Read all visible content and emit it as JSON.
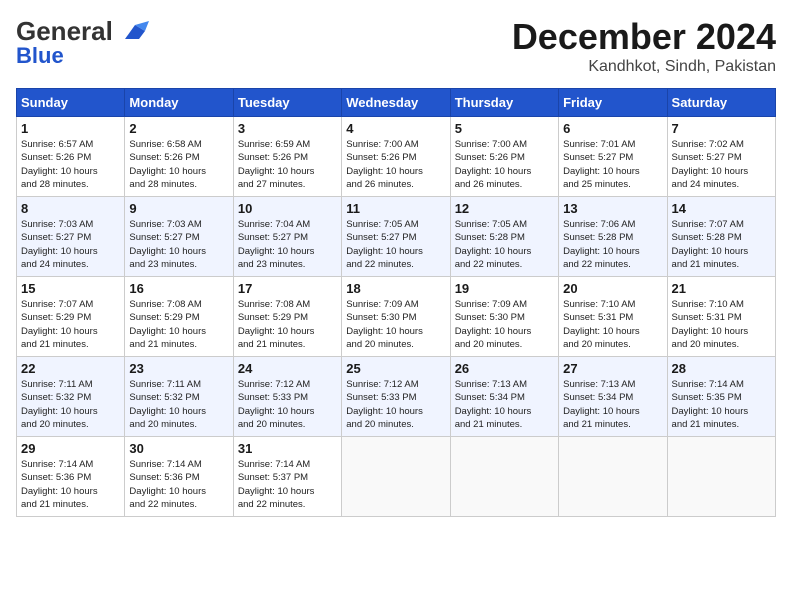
{
  "header": {
    "logo_general": "General",
    "logo_blue": "Blue",
    "month": "December 2024",
    "location": "Kandhkot, Sindh, Pakistan"
  },
  "weekdays": [
    "Sunday",
    "Monday",
    "Tuesday",
    "Wednesday",
    "Thursday",
    "Friday",
    "Saturday"
  ],
  "weeks": [
    [
      {
        "day": "1",
        "detail": "Sunrise: 6:57 AM\nSunset: 5:26 PM\nDaylight: 10 hours\nand 28 minutes."
      },
      {
        "day": "2",
        "detail": "Sunrise: 6:58 AM\nSunset: 5:26 PM\nDaylight: 10 hours\nand 28 minutes."
      },
      {
        "day": "3",
        "detail": "Sunrise: 6:59 AM\nSunset: 5:26 PM\nDaylight: 10 hours\nand 27 minutes."
      },
      {
        "day": "4",
        "detail": "Sunrise: 7:00 AM\nSunset: 5:26 PM\nDaylight: 10 hours\nand 26 minutes."
      },
      {
        "day": "5",
        "detail": "Sunrise: 7:00 AM\nSunset: 5:26 PM\nDaylight: 10 hours\nand 26 minutes."
      },
      {
        "day": "6",
        "detail": "Sunrise: 7:01 AM\nSunset: 5:27 PM\nDaylight: 10 hours\nand 25 minutes."
      },
      {
        "day": "7",
        "detail": "Sunrise: 7:02 AM\nSunset: 5:27 PM\nDaylight: 10 hours\nand 24 minutes."
      }
    ],
    [
      {
        "day": "8",
        "detail": "Sunrise: 7:03 AM\nSunset: 5:27 PM\nDaylight: 10 hours\nand 24 minutes."
      },
      {
        "day": "9",
        "detail": "Sunrise: 7:03 AM\nSunset: 5:27 PM\nDaylight: 10 hours\nand 23 minutes."
      },
      {
        "day": "10",
        "detail": "Sunrise: 7:04 AM\nSunset: 5:27 PM\nDaylight: 10 hours\nand 23 minutes."
      },
      {
        "day": "11",
        "detail": "Sunrise: 7:05 AM\nSunset: 5:27 PM\nDaylight: 10 hours\nand 22 minutes."
      },
      {
        "day": "12",
        "detail": "Sunrise: 7:05 AM\nSunset: 5:28 PM\nDaylight: 10 hours\nand 22 minutes."
      },
      {
        "day": "13",
        "detail": "Sunrise: 7:06 AM\nSunset: 5:28 PM\nDaylight: 10 hours\nand 22 minutes."
      },
      {
        "day": "14",
        "detail": "Sunrise: 7:07 AM\nSunset: 5:28 PM\nDaylight: 10 hours\nand 21 minutes."
      }
    ],
    [
      {
        "day": "15",
        "detail": "Sunrise: 7:07 AM\nSunset: 5:29 PM\nDaylight: 10 hours\nand 21 minutes."
      },
      {
        "day": "16",
        "detail": "Sunrise: 7:08 AM\nSunset: 5:29 PM\nDaylight: 10 hours\nand 21 minutes."
      },
      {
        "day": "17",
        "detail": "Sunrise: 7:08 AM\nSunset: 5:29 PM\nDaylight: 10 hours\nand 21 minutes."
      },
      {
        "day": "18",
        "detail": "Sunrise: 7:09 AM\nSunset: 5:30 PM\nDaylight: 10 hours\nand 20 minutes."
      },
      {
        "day": "19",
        "detail": "Sunrise: 7:09 AM\nSunset: 5:30 PM\nDaylight: 10 hours\nand 20 minutes."
      },
      {
        "day": "20",
        "detail": "Sunrise: 7:10 AM\nSunset: 5:31 PM\nDaylight: 10 hours\nand 20 minutes."
      },
      {
        "day": "21",
        "detail": "Sunrise: 7:10 AM\nSunset: 5:31 PM\nDaylight: 10 hours\nand 20 minutes."
      }
    ],
    [
      {
        "day": "22",
        "detail": "Sunrise: 7:11 AM\nSunset: 5:32 PM\nDaylight: 10 hours\nand 20 minutes."
      },
      {
        "day": "23",
        "detail": "Sunrise: 7:11 AM\nSunset: 5:32 PM\nDaylight: 10 hours\nand 20 minutes."
      },
      {
        "day": "24",
        "detail": "Sunrise: 7:12 AM\nSunset: 5:33 PM\nDaylight: 10 hours\nand 20 minutes."
      },
      {
        "day": "25",
        "detail": "Sunrise: 7:12 AM\nSunset: 5:33 PM\nDaylight: 10 hours\nand 20 minutes."
      },
      {
        "day": "26",
        "detail": "Sunrise: 7:13 AM\nSunset: 5:34 PM\nDaylight: 10 hours\nand 21 minutes."
      },
      {
        "day": "27",
        "detail": "Sunrise: 7:13 AM\nSunset: 5:34 PM\nDaylight: 10 hours\nand 21 minutes."
      },
      {
        "day": "28",
        "detail": "Sunrise: 7:14 AM\nSunset: 5:35 PM\nDaylight: 10 hours\nand 21 minutes."
      }
    ],
    [
      {
        "day": "29",
        "detail": "Sunrise: 7:14 AM\nSunset: 5:36 PM\nDaylight: 10 hours\nand 21 minutes."
      },
      {
        "day": "30",
        "detail": "Sunrise: 7:14 AM\nSunset: 5:36 PM\nDaylight: 10 hours\nand 22 minutes."
      },
      {
        "day": "31",
        "detail": "Sunrise: 7:14 AM\nSunset: 5:37 PM\nDaylight: 10 hours\nand 22 minutes."
      },
      {
        "day": "",
        "detail": ""
      },
      {
        "day": "",
        "detail": ""
      },
      {
        "day": "",
        "detail": ""
      },
      {
        "day": "",
        "detail": ""
      }
    ]
  ]
}
